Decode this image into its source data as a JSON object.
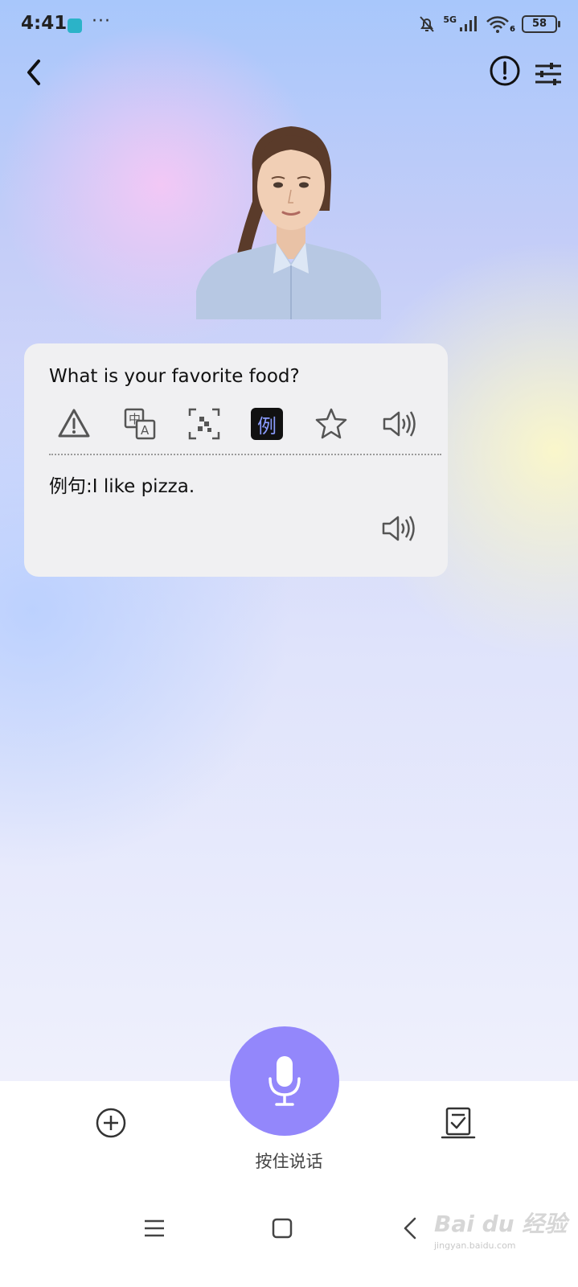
{
  "status_bar": {
    "time": "4:41",
    "more": "···",
    "network": "5G",
    "wifi_badge": "6",
    "battery": "58"
  },
  "card": {
    "question": "What is your favorite food?",
    "active_tool_label": "例",
    "example_sentence": "例句:I like pizza."
  },
  "bottom": {
    "mic_label": "按住说话"
  },
  "watermark": {
    "brand": "Bai du 经验",
    "url": "jingyan.baidu.com"
  },
  "colors": {
    "mic_button": "#9387fb",
    "active_tool_bg": "#111111",
    "active_tool_text": "#8a9cff",
    "card_bg": "#f0f0f2"
  },
  "icons": [
    "back-icon",
    "info-icon",
    "settings-icon",
    "warning-icon",
    "translate-icon",
    "scan-icon",
    "example-icon",
    "star-icon",
    "speaker-icon",
    "plus-icon",
    "note-check-icon",
    "microphone-icon",
    "menu-icon",
    "home-icon",
    "nav-back-icon"
  ]
}
